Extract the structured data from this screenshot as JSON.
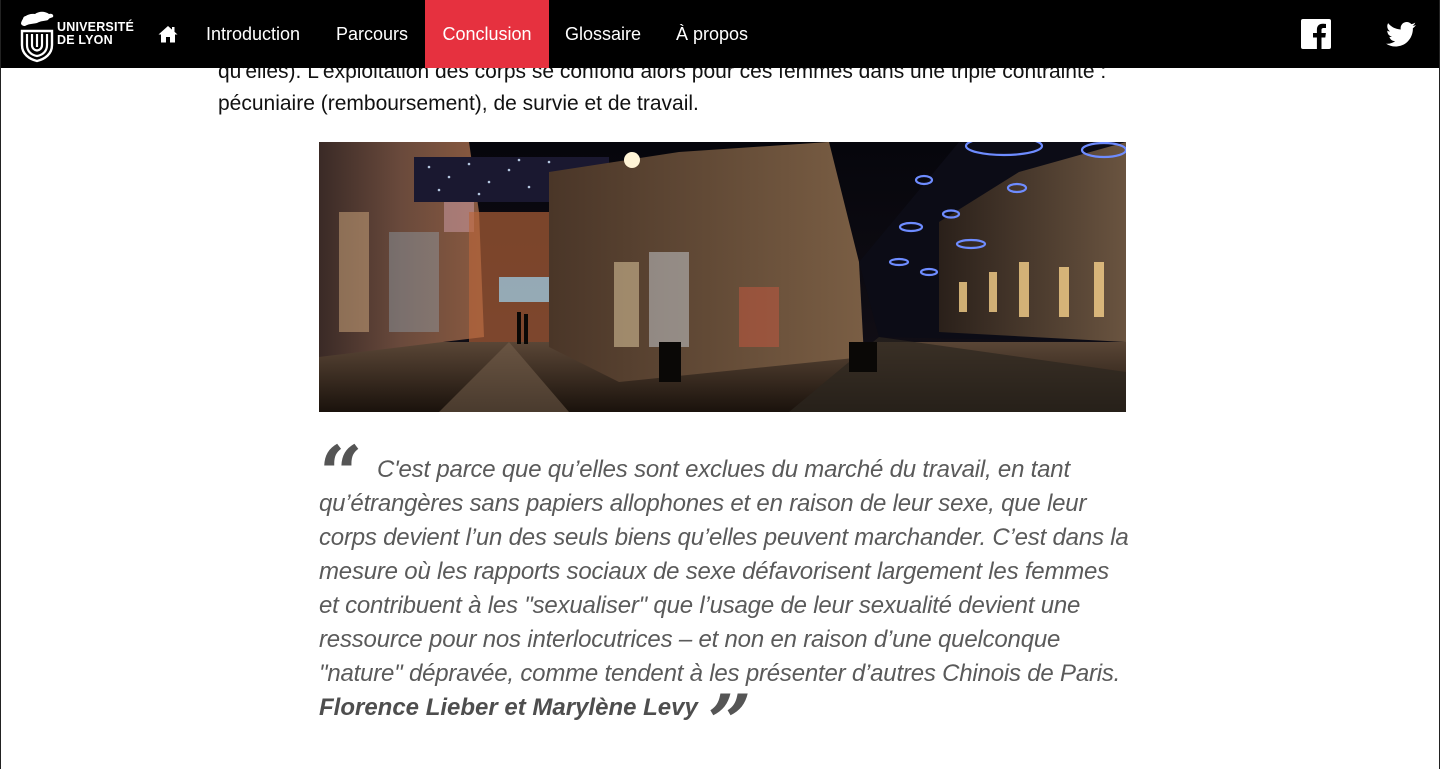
{
  "navbar": {
    "logo_line1": "UNIVERSITÉ",
    "logo_line2": "DE LYON",
    "items": [
      {
        "label": "Introduction",
        "active": false
      },
      {
        "label": "Parcours",
        "active": false
      },
      {
        "label": "Conclusion",
        "active": true
      },
      {
        "label": "Glossaire",
        "active": false
      },
      {
        "label": "À propos",
        "active": false
      }
    ],
    "icons": [
      "lion-logo-icon",
      "home-icon",
      "facebook-icon",
      "twitter-icon"
    ],
    "active_color": "#e6313f"
  },
  "article": {
    "paragraph_line1": "qu'elles). L'exploitation des corps se confond alors pour ces femmes dans une triple contrainte :",
    "paragraph_line2": "pécuniaire (remboursement), de survie et de travail.",
    "quote": {
      "open_mark": "“",
      "text": "C'est parce que qu’elles sont exclues du marché du travail, en tant qu’étrangères sans papiers allophones et en raison de leur sexe, que leur corps devient l’un des seuls biens qu’elles peuvent marchander. C’est dans la mesure où les rapports sociaux de sexe défavorisent largement les femmes et contribuent à les \"sexualiser\" que l’usage de leur sexualité devient une ressource pour nos interlocutrices – et non en raison d’une quelconque \"nature\" dépravée, comme tendent à les présenter d’autres Chinois de Paris.",
      "author": "Florence Lieber et Marylène Levy",
      "close_mark": "”"
    }
  }
}
